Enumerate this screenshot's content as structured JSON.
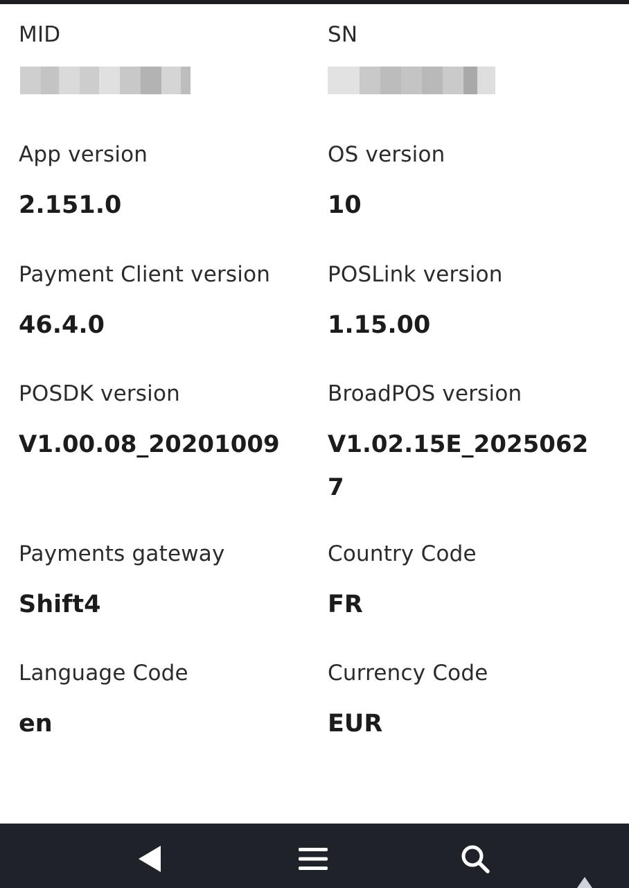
{
  "fields": {
    "mid": {
      "label": "MID",
      "value": ""
    },
    "sn": {
      "label": "SN",
      "value": ""
    },
    "app_version": {
      "label": "App version",
      "value": "2.151.0"
    },
    "os_version": {
      "label": "OS version",
      "value": "10"
    },
    "payment_client_version": {
      "label": "Payment Client version",
      "value": "46.4.0"
    },
    "poslink_version": {
      "label": "POSLink version",
      "value": "1.15.00"
    },
    "posdk_version": {
      "label": "POSDK version",
      "value": "V1.00.08_20201009"
    },
    "broadpos_version": {
      "label": "BroadPOS version",
      "value": "V1.02.15E_20250627"
    },
    "payments_gateway": {
      "label": "Payments gateway",
      "value": "Shift4"
    },
    "country_code": {
      "label": "Country Code",
      "value": "FR"
    },
    "language_code": {
      "label": "Language Code",
      "value": "en"
    },
    "currency_code": {
      "label": "Currency Code",
      "value": "EUR"
    }
  },
  "nav": {
    "back_icon": "back-triangle-icon",
    "menu_icon": "menu-icon",
    "search_icon": "search-icon",
    "extra_icon": "up-arrow-icon"
  },
  "colors": {
    "background": "#ffffff",
    "text": "#1c1c1c",
    "nav_bar": "#20222a",
    "nav_icon": "#ffffff"
  }
}
